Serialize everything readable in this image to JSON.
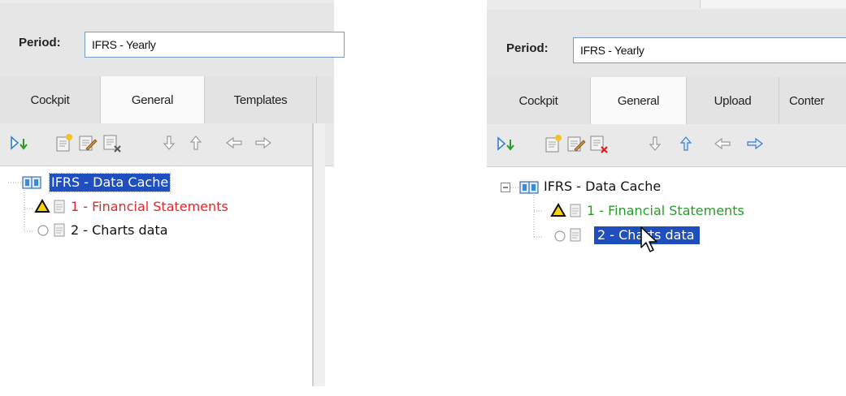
{
  "left_panel": {
    "period_label": "Period:",
    "period_value": "IFRS - Yearly",
    "tabs": [
      "Cockpit",
      "General",
      "Templates"
    ],
    "active_tab": "General",
    "tree": {
      "root_label": "IFRS - Data Cache",
      "children": [
        {
          "label": "1 - Financial Statements",
          "status": "warning",
          "color": "#e8242b"
        },
        {
          "label": "2 - Charts data",
          "status": "empty",
          "color": "#111111"
        }
      ],
      "selected": "IFRS - Data Cache"
    }
  },
  "right_panel": {
    "period_label": "Period:",
    "period_value": "IFRS - Yearly",
    "tabs": [
      "Cockpit",
      "General",
      "Upload",
      "Conter"
    ],
    "active_tab": "General",
    "tree": {
      "root_label": "IFRS - Data Cache",
      "children": [
        {
          "label": "1 - Financial Statements",
          "status": "warning",
          "color": "#2a9a2a"
        },
        {
          "label": "2 - Charts data",
          "status": "empty",
          "color": "#ffffff"
        }
      ],
      "selected": "2 - Charts data"
    }
  },
  "toolbar_icons": [
    "run-down-icon",
    "new-item-icon",
    "edit-item-icon",
    "delete-item-icon",
    "move-down-icon",
    "move-up-icon",
    "move-left-icon",
    "move-right-icon"
  ],
  "colors": {
    "selection": "#1f4fbf",
    "warning": "#f5d20a",
    "accent": "#3a8bd8"
  }
}
